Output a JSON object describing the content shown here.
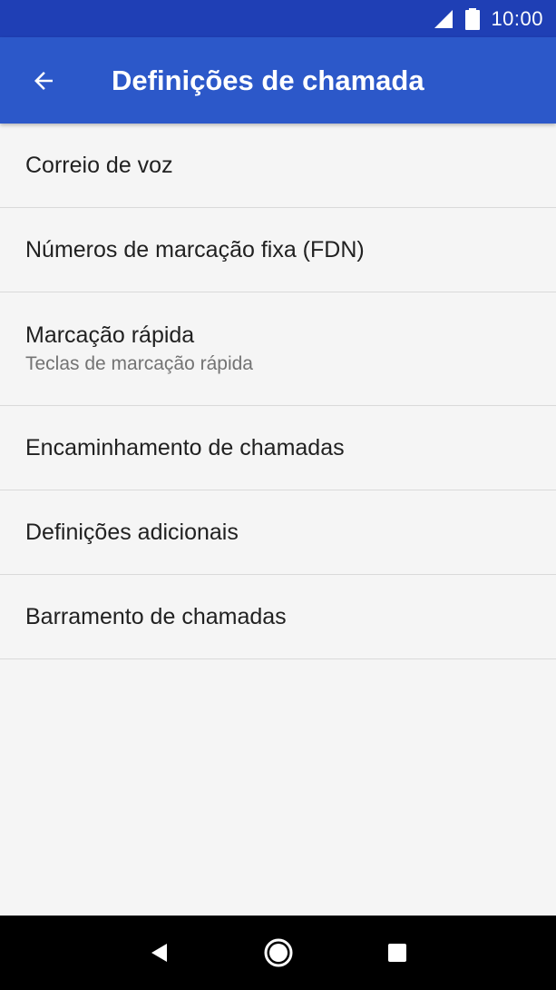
{
  "status_bar": {
    "time": "10:00",
    "signal_icon": "signal-icon",
    "battery_icon": "battery-icon"
  },
  "app_bar": {
    "title": "Definições de chamada",
    "back_icon": "arrow-back-icon",
    "color": "#2c58c9"
  },
  "settings": {
    "items": [
      {
        "title": "Correio de voz"
      },
      {
        "title": "Números de marcação fixa (FDN)"
      },
      {
        "title": "Marcação rápida",
        "subtitle": "Teclas de marcação rápida"
      },
      {
        "title": "Encaminhamento de chamadas"
      },
      {
        "title": "Definições adicionais"
      },
      {
        "title": "Barramento de chamadas"
      }
    ]
  },
  "nav_bar": {
    "back_icon": "nav-back-icon",
    "home_icon": "nav-home-icon",
    "recents_icon": "nav-recents-icon"
  },
  "colors": {
    "status_bar": "#1f3fb5",
    "app_bar": "#2c58c9",
    "background": "#f5f5f5",
    "divider": "#dadada"
  }
}
